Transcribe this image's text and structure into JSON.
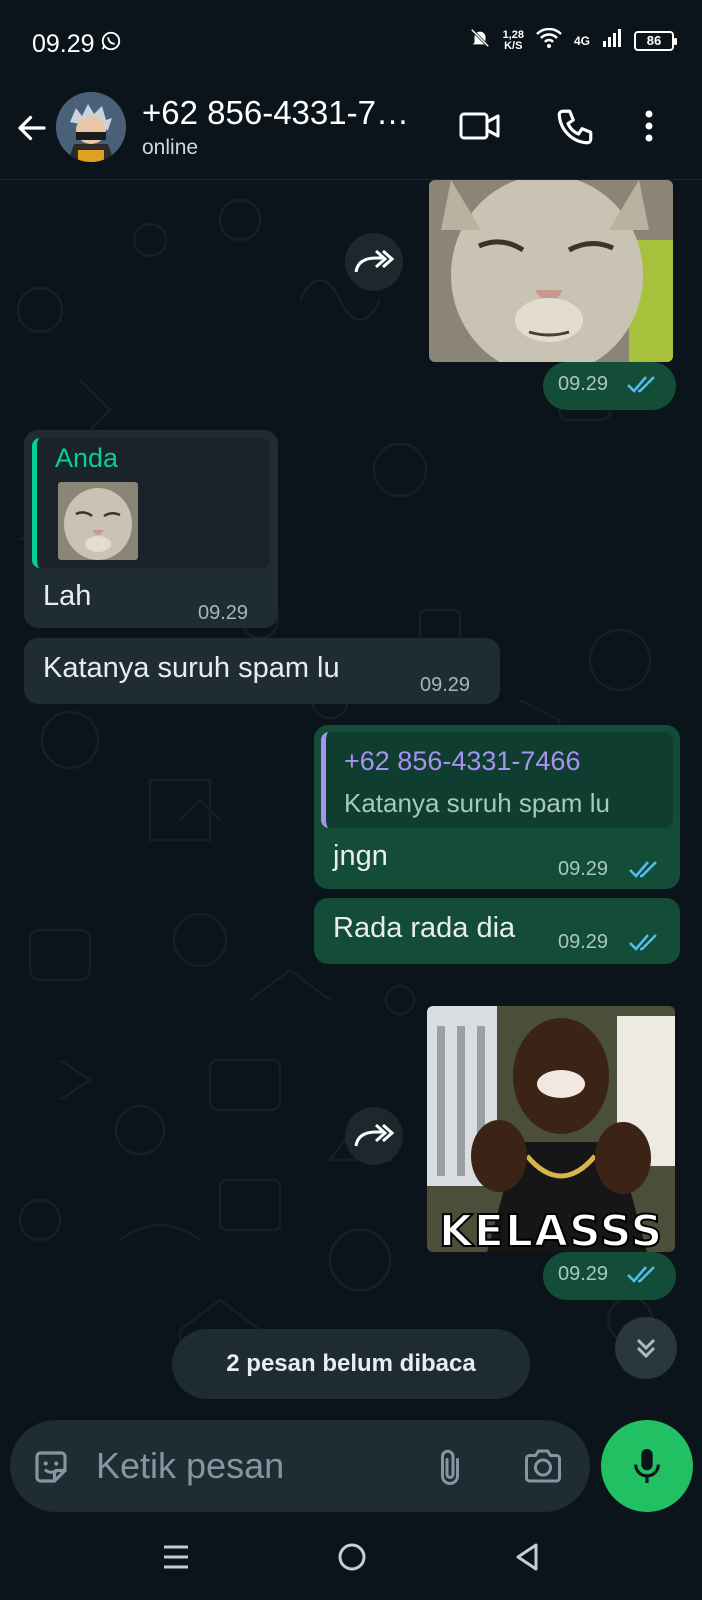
{
  "status_bar": {
    "time": "09.29",
    "speed_top": "1,28",
    "speed_bottom": "K/S",
    "network": "4G",
    "battery": "86"
  },
  "header": {
    "contact_name": "+62 856-4331-7…",
    "status": "online"
  },
  "messages": {
    "m1": {
      "time": "09.29"
    },
    "m2": {
      "quote_author": "Anda",
      "text": "Lah",
      "time": "09.29"
    },
    "m3": {
      "text": "Katanya suruh spam lu",
      "time": "09.29"
    },
    "m4": {
      "quote_author": "+62 856-4331-7466",
      "quote_text": "Katanya suruh spam lu",
      "text": "jngn",
      "time": "09.29"
    },
    "m5": {
      "text": "Rada rada dia",
      "time": "09.29"
    },
    "m6": {
      "sticker_caption": "KELASSS",
      "time": "09.29"
    }
  },
  "unread_banner": "2 pesan belum dibaca",
  "composer": {
    "placeholder": "Ketik pesan"
  },
  "colors": {
    "background": "#0b141a",
    "incoming_bubble": "#202c33",
    "outgoing_bubble": "#144d37",
    "accent_green": "#21c063",
    "read_ticks": "#53bdeb"
  }
}
